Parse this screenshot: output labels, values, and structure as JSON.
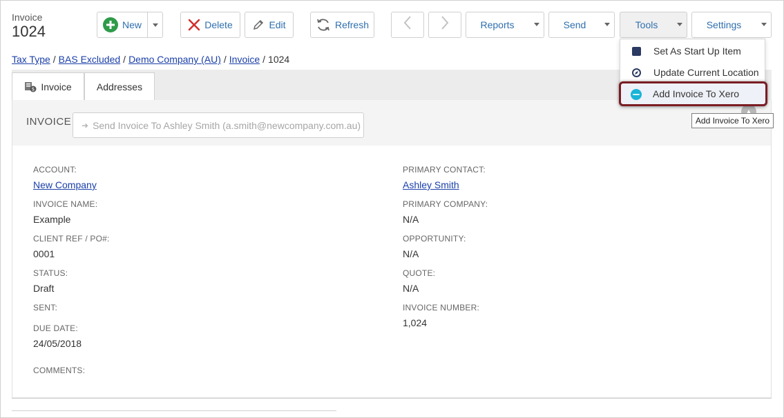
{
  "header": {
    "record_type": "Invoice",
    "record_id": "1024"
  },
  "toolbar": {
    "new_label": "New",
    "delete_label": "Delete",
    "edit_label": "Edit",
    "refresh_label": "Refresh",
    "reports_label": "Reports",
    "send_label": "Send",
    "tools_label": "Tools",
    "settings_label": "Settings"
  },
  "breadcrumb": {
    "items": [
      "Tax Type",
      "BAS Excluded",
      "Demo Company (AU)",
      "Invoice"
    ],
    "current": "1024"
  },
  "tabs": {
    "invoice": "Invoice",
    "addresses": "Addresses"
  },
  "invoice_section": {
    "heading": "INVOICE",
    "send_placeholder": "Send Invoice To Ashley Smith (a.smith@newcompany.com.au)"
  },
  "left_fields": {
    "account_label": "ACCOUNT:",
    "account_value": "New Company",
    "invoice_name_label": "INVOICE NAME:",
    "invoice_name_value": "Example",
    "client_ref_label": "CLIENT REF / PO#:",
    "client_ref_value": "0001",
    "status_label": "STATUS:",
    "status_value": "Draft",
    "sent_label": "SENT:",
    "due_date_label": "DUE DATE:",
    "due_date_value": "24/05/2018",
    "comments_label": "COMMENTS:"
  },
  "right_fields": {
    "primary_contact_label": "PRIMARY CONTACT:",
    "primary_contact_value": "Ashley Smith",
    "primary_company_label": "PRIMARY COMPANY:",
    "primary_company_value": "N/A",
    "opportunity_label": "OPPORTUNITY:",
    "opportunity_value": "N/A",
    "quote_label": "QUOTE:",
    "quote_value": "N/A",
    "invoice_number_label": "INVOICE NUMBER:",
    "invoice_number_value": "1,024"
  },
  "tools_menu": {
    "items": [
      "Set As Start Up Item",
      "Update Current Location",
      "Add Invoice To Xero"
    ]
  },
  "tooltip": "Add Invoice To Xero",
  "colors": {
    "link": "#1a3fa8",
    "button_text": "#2f6fae",
    "new_green": "#2e9b49",
    "delete_red": "#d32f2f",
    "highlight_border": "#7a1c23",
    "xero_blue": "#1ab4d7"
  }
}
